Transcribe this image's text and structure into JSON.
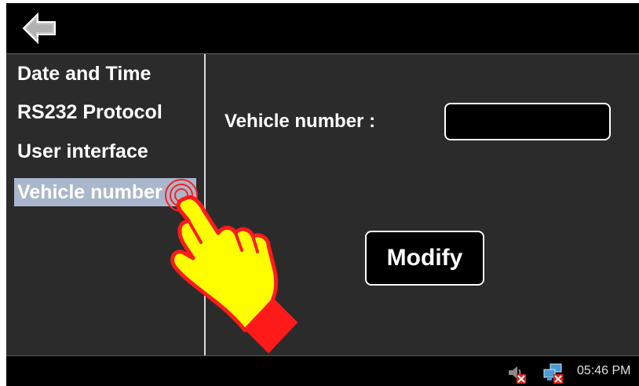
{
  "topbar": {
    "back_icon": "back-arrow-icon"
  },
  "sidebar": {
    "items": [
      {
        "label": "Date and Time",
        "selected": false
      },
      {
        "label": "RS232 Protocol",
        "selected": false
      },
      {
        "label": "User interface",
        "selected": false
      },
      {
        "label": "Vehicle number",
        "selected": true
      }
    ]
  },
  "main": {
    "vehicle_label": "Vehicle number :",
    "vehicle_value": "",
    "modify_label": "Modify"
  },
  "taskbar": {
    "icons": [
      "volume-muted-icon",
      "network-disconnected-icon"
    ],
    "clock": "05:46 PM"
  },
  "overlay": {
    "icon": "tap-hand-icon"
  },
  "colors": {
    "background": "#2b2b2b",
    "selection": "#a9b6cc",
    "hand_fill": "#ffff00",
    "hand_cuff": "#ff1a1a",
    "error_badge": "#e02020"
  }
}
